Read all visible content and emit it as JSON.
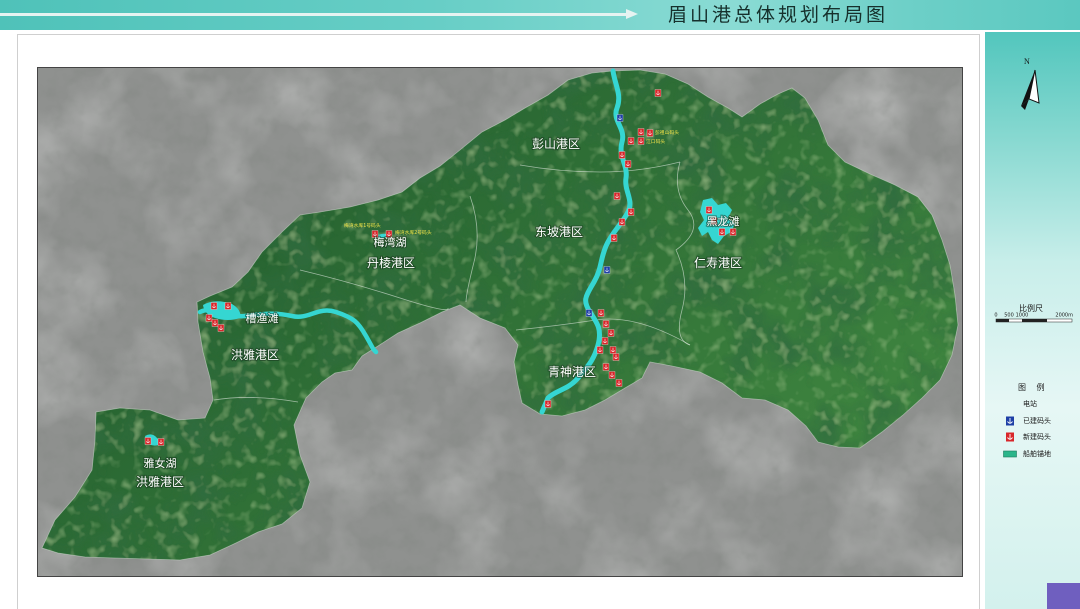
{
  "header": {
    "title": "眉山港总体规划布局图"
  },
  "map": {
    "region_labels": {
      "pengshan": "彭山港区",
      "dongpo": "东坡港区",
      "danleng": "丹棱港区",
      "hongya_north": "洪雅港区",
      "qingshen": "青神港区",
      "renshou": "仁寿港区",
      "hongya_south": "洪雅港区"
    },
    "water_labels": {
      "meiwan": "梅湾湖",
      "caoyu": "槽渔滩",
      "heilong": "黑龙滩",
      "yanv": "雅女湖"
    },
    "dock_labels": [
      "梅湾水库1号码头",
      "梅湾水库2号码头",
      "彭祖山码头",
      "江口码头"
    ],
    "colors": {
      "background": "#8f918f",
      "land": "#2f7236",
      "river": "#35d6d2",
      "label": "#ffffff",
      "dock_label": "#f3e44a"
    }
  },
  "north_arrow": {
    "label": "N",
    "icon": "north-arrow-icon"
  },
  "scale_bar": {
    "title": "比例尺",
    "ticks": [
      "0",
      "500",
      "1000",
      "2000m"
    ]
  },
  "legend": {
    "title": "图 例",
    "items": [
      {
        "label": "电站",
        "icon": "hydropower-wave-icon",
        "color": "#1f9e94"
      },
      {
        "label": "已建码头",
        "icon": "anchor-icon",
        "color": "#1e3fa6"
      },
      {
        "label": "新建码头",
        "icon": "anchor-icon",
        "color": "#d8262a"
      },
      {
        "label": "船舶锚地",
        "icon": "anchorage-area-swatch",
        "color": "#2bb58a"
      }
    ]
  },
  "colors": {
    "header": "#5bc8c0",
    "side_panel": "#c8eeea",
    "accent_square": "#6f5fbf"
  }
}
